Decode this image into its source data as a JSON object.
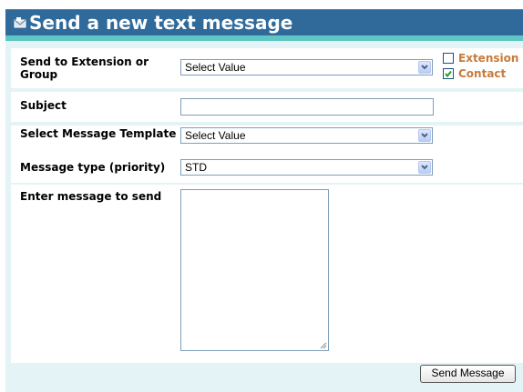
{
  "header": {
    "title": "Send a new text message",
    "icon": "envelope-icon"
  },
  "form": {
    "send_to": {
      "label": "Send to Extension or Group",
      "value": "Select Value"
    },
    "filters": {
      "extension": {
        "label": "Extension",
        "checked": false
      },
      "contact": {
        "label": "Contact",
        "checked": true
      }
    },
    "subject": {
      "label": "Subject",
      "value": ""
    },
    "template": {
      "label": "Select Message Template",
      "value": "Select Value"
    },
    "message_type": {
      "label": "Message type (priority)",
      "value": "STD"
    },
    "message": {
      "label": "Enter message to send",
      "value": ""
    },
    "submit_label": "Send Message"
  },
  "colors": {
    "header_bg": "#2f6a9b",
    "accent_band": "#5fc7c3",
    "panel_bg": "#e4f4f6",
    "checkbox_label": "#c87a3a"
  }
}
